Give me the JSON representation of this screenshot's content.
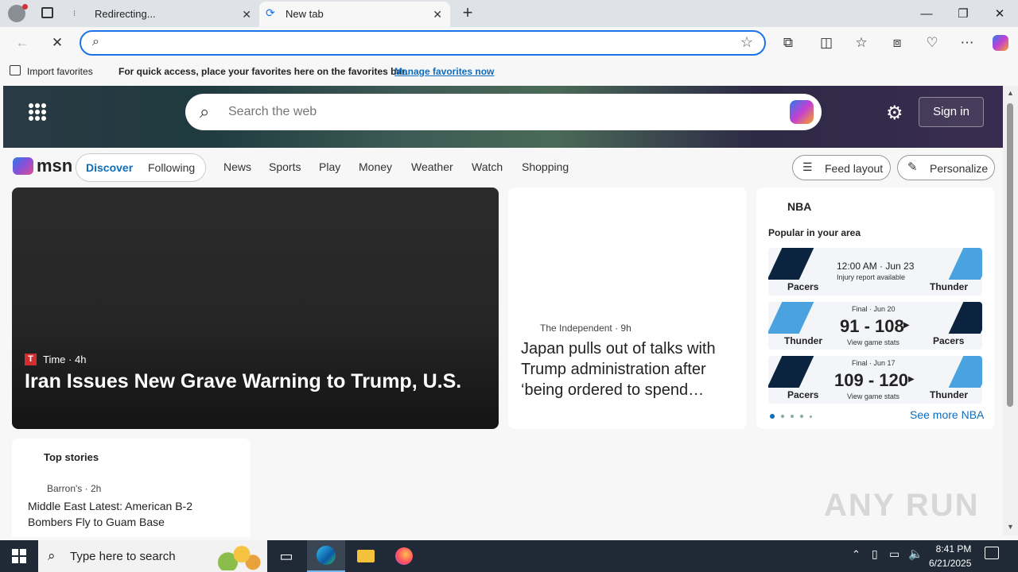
{
  "browser": {
    "tabs": [
      {
        "label": "Redirecting..."
      },
      {
        "label": "New tab"
      }
    ],
    "address_value": "",
    "favorites_bar": {
      "import_label": "Import favorites",
      "message": "For quick access, place your favorites here on the favorites bar.",
      "manage_link": "Manage favorites now"
    }
  },
  "msn": {
    "search_placeholder": "Search the web",
    "sign_in": "Sign in",
    "logo": "msn",
    "nav": {
      "discover": "Discover",
      "following": "Following",
      "links": [
        "News",
        "Sports",
        "Play",
        "Money",
        "Weather",
        "Watch",
        "Shopping"
      ],
      "feed_layout": "Feed layout",
      "personalize": "Personalize"
    },
    "hero_story": {
      "source": "Time",
      "age": "4h",
      "headline": "Iran Issues New Grave Warning to Trump, U.S."
    },
    "second_story": {
      "source": "The Independent",
      "age": "9h",
      "headline": "Japan pulls out of talks with Trump administration after ‘being ordered to spend…"
    },
    "nba": {
      "title": "NBA",
      "subtitle": "Popular in your area",
      "games": [
        {
          "left_team": "Pacers",
          "right_team": "Thunder",
          "top": "12:00 AM · Jun 23",
          "bottom": "Injury report available",
          "score": ""
        },
        {
          "left_team": "Thunder",
          "right_team": "Pacers",
          "top": "Final · Jun 20",
          "score": "91 - 108",
          "bottom": "View game stats"
        },
        {
          "left_team": "Pacers",
          "right_team": "Thunder",
          "top": "Final · Jun 17",
          "score": "109 - 120",
          "bottom": "View game stats"
        }
      ],
      "see_more": "See more NBA"
    },
    "top_stories": {
      "title": "Top stories",
      "items": [
        {
          "source": "Barron's",
          "age": "2h",
          "headline_line1": "Middle East Latest: American B-2",
          "headline_line2": "Bombers Fly to Guam Base"
        }
      ]
    }
  },
  "taskbar": {
    "search_placeholder": "Type here to search",
    "time": "8:41 PM",
    "date": "6/21/2025"
  },
  "colors": {
    "accent": "#0f6cbd",
    "address_border": "#1a73e8",
    "taskbar": "#1f2a36",
    "pacers_navy": "#0c2340",
    "thunder_blue": "#4aa3df"
  },
  "watermark": "ANY RUN"
}
